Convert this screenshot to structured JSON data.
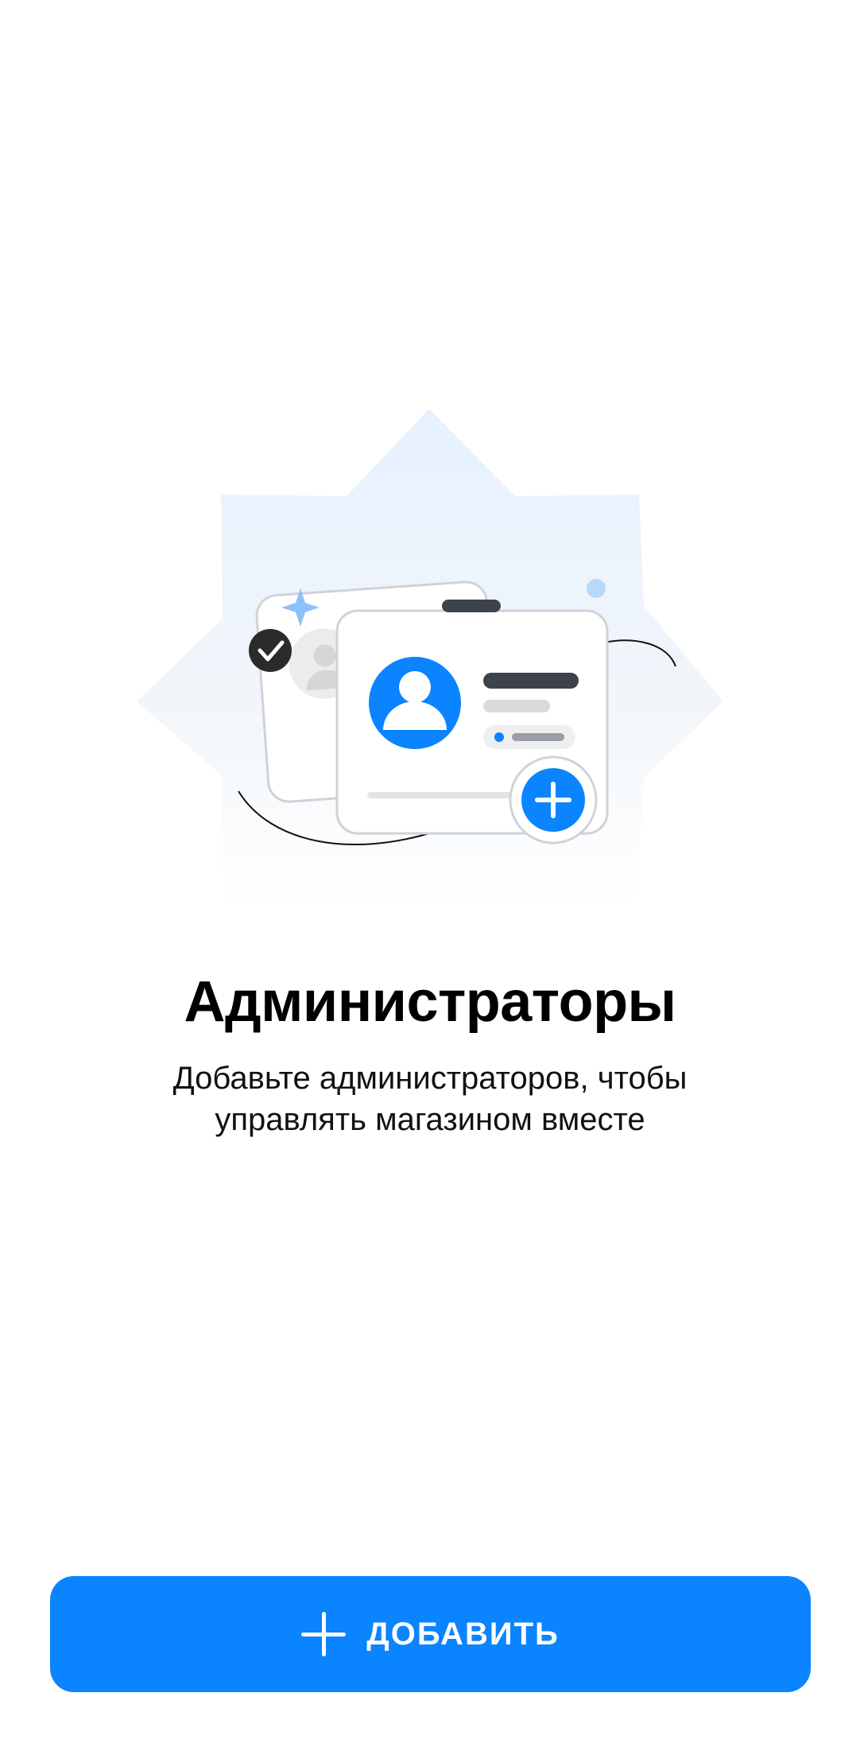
{
  "empty_state": {
    "title": "Администраторы",
    "subtitle": "Добавьте администраторов, чтобы управлять магазином вместе"
  },
  "primary_action": {
    "label": "ДОБАВИТЬ",
    "icon": "plus-icon"
  },
  "colors": {
    "accent": "#0a84ff",
    "background": "#ffffff",
    "text": "#000000"
  }
}
